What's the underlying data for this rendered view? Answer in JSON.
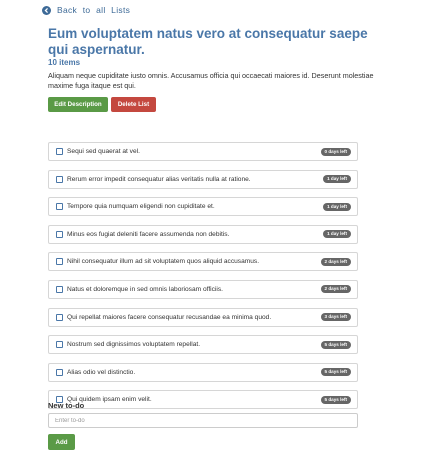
{
  "nav": {
    "back_label": "Back to all Lists"
  },
  "list": {
    "title": "Eum voluptatem natus vero at consequatur saepe qui aspernatur.",
    "item_count": "10 items",
    "description": "Aliquam neque cupiditate iusto omnis. Accusamus officia qui occaecati maiores id. Deserunt molestiae maxime fuga itaque est qui."
  },
  "actions": {
    "edit_label": "Edit Description",
    "delete_label": "Delete List"
  },
  "colors": {
    "link": "#3d6a97",
    "title": "#4a77a8",
    "edit": "#5a9a46",
    "delete": "#c4483f",
    "badge": "#666666"
  },
  "todos": [
    {
      "text": "Sequi sed quaerat at vel.",
      "badge": "0 days left"
    },
    {
      "text": "Rerum error impedit consequatur alias veritatis nulla at ratione.",
      "badge": "1 day left"
    },
    {
      "text": "Tempore quia numquam eligendi non cupiditate et.",
      "badge": "1 day left"
    },
    {
      "text": "Minus eos fugiat deleniti facere assumenda non debitis.",
      "badge": "1 day left"
    },
    {
      "text": "Nihil consequatur illum ad sit voluptatem quos aliquid accusamus.",
      "badge": "2 days left"
    },
    {
      "text": "Natus et doloremque in sed omnis laboriosam officiis.",
      "badge": "2 days left"
    },
    {
      "text": "Qui repellat maiores facere consequatur recusandae ea minima quod.",
      "badge": "3 days left"
    },
    {
      "text": "Nostrum sed dignissimos voluptatem repellat.",
      "badge": "5 days left"
    },
    {
      "text": "Alias odio vel distinctio.",
      "badge": "5 days left"
    },
    {
      "text": "Qui quidem ipsam enim velit.",
      "badge": "5 days left"
    }
  ],
  "new_todo": {
    "label": "New to-do",
    "placeholder": "Enter to-do",
    "value": "",
    "add_label": "Add"
  }
}
